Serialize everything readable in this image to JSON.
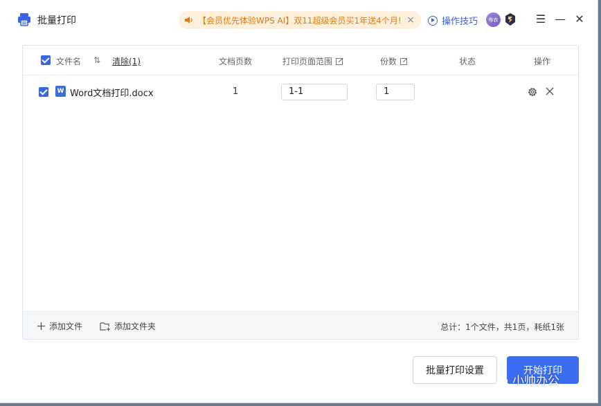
{
  "app": {
    "title": "批量打印"
  },
  "promo": {
    "text": "【会员优先体验WPS AI】双11超级会员买1年送4个月!",
    "close": "×"
  },
  "header": {
    "tips_label": "操作技巧",
    "avatar_text": "布衣"
  },
  "window_controls": {
    "menu": "☰",
    "minimize": "—",
    "close": "✕"
  },
  "table": {
    "headers": {
      "filename": "文件名",
      "clear": "清除(1)",
      "pages": "文档页数",
      "range": "打印页面范围",
      "copies": "份数",
      "status": "状态",
      "actions": "操作"
    },
    "rows": [
      {
        "filename": "Word文档打印.docx",
        "pages": "1",
        "range": "1-1",
        "copies": "1",
        "status": ""
      }
    ]
  },
  "footer": {
    "add_file": "添加文件",
    "add_folder": "添加文件夹",
    "summary": "总计：1个文件，共1页，耗纸1张"
  },
  "buttons": {
    "settings": "批量打印设置",
    "start": "开始打印"
  },
  "watermark": "小帅办公",
  "colors": {
    "accent": "#3a6cf4",
    "promo_text": "#e07a10",
    "promo_bg": "#fdf0dd",
    "link": "#3a5fdc"
  },
  "icons": {
    "app": "printer-icon",
    "promo": "speaker-icon",
    "tips": "play-circle-icon",
    "row_file": "word-doc-icon"
  }
}
